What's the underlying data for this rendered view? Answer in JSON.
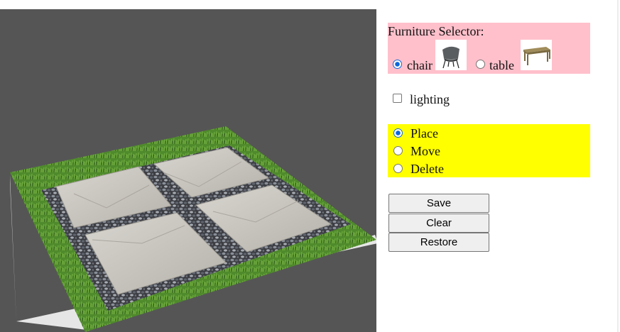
{
  "furniture_selector": {
    "title": "Furniture Selector:",
    "options": [
      {
        "label": "chair",
        "checked": true,
        "icon": "chair-thumbnail"
      },
      {
        "label": "table",
        "checked": false,
        "icon": "table-thumbnail"
      }
    ]
  },
  "lighting": {
    "label": "lighting",
    "checked": false
  },
  "mode": {
    "options": [
      {
        "label": "Place",
        "checked": true
      },
      {
        "label": "Move",
        "checked": false
      },
      {
        "label": "Delete",
        "checked": false
      }
    ]
  },
  "buttons": {
    "save": "Save",
    "clear": "Clear",
    "restore": "Restore"
  },
  "colors": {
    "viewport_bg": "#555555",
    "selector_bg": "#ffc0cb",
    "mode_bg": "#ffff00",
    "radio_accent": "#0b66d8"
  },
  "scene": {
    "description_icon": "3d-patio-tile-scene"
  }
}
